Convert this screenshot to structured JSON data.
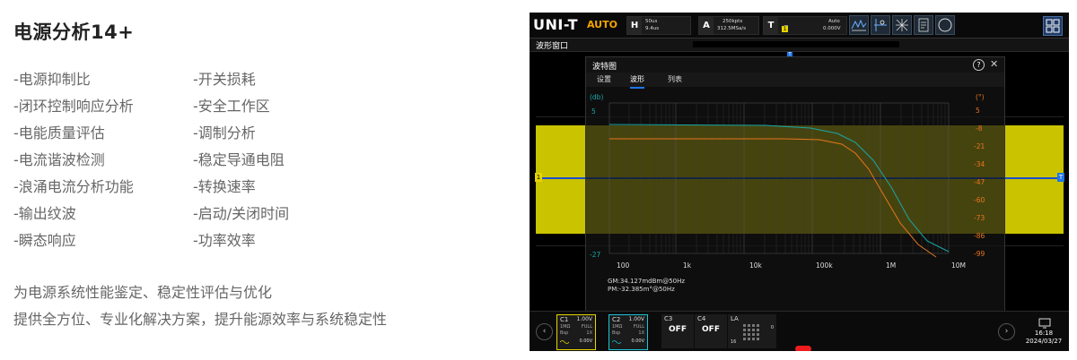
{
  "left": {
    "title": "电源分析14+",
    "features_col1": [
      "-电源抑制比",
      "-闭环控制响应分析",
      "-电能质量评估",
      "-电流谐波检测",
      "-浪涌电流分析功能",
      "-输出纹波",
      "-瞬态响应"
    ],
    "features_col2": [
      "-开关损耗",
      "-安全工作区",
      "-调制分析",
      "-稳定导通电阻",
      "-转换速率",
      "-启动/关闭时间",
      "-功率效率"
    ],
    "desc_line1": "为电源系统性能鉴定、稳定性评估与优化",
    "desc_line2": "提供全方位、专业化解决方案，提升能源效率与系统稳定性"
  },
  "scope": {
    "logo": "UNI-T",
    "mode": "AUTO",
    "horizontal": {
      "key": "H",
      "line1": "50us",
      "line2": "9.4us"
    },
    "acquire": {
      "key": "A",
      "line1": "250kpts",
      "line2": "312.5MSa/s"
    },
    "trigger": {
      "key": "T",
      "channel": "1",
      "line1": "Auto",
      "line2": "0.000V"
    },
    "window_title": "波形窗口",
    "marker_left": "1",
    "marker_right": "T",
    "dialog": {
      "title": "波特图",
      "help": "?",
      "close": "✕",
      "tabs": [
        "设置",
        "波形",
        "列表"
      ],
      "active_tab": 1,
      "left_unit": "(db)",
      "right_unit": "(°)",
      "gain_ticks": [
        5,
        "",
        "",
        "",
        "",
        "",
        "",
        "",
        "",
        "",
        "-27"
      ],
      "phase_ticks": [
        "(°)",
        "5",
        "-8",
        "-21",
        "-34",
        "-47",
        "-60",
        "-73",
        "-86",
        "-99"
      ],
      "freq_ticks": [
        "100",
        "1k",
        "10k",
        "100k",
        "1M",
        "10M"
      ],
      "gm": "GM:34.127mdBm@50Hz",
      "pm": "PM:-32.385m°@50Hz"
    },
    "channels": [
      {
        "name": "C1",
        "volt": "1.00V",
        "imp": "1MΩ",
        "bw": "FULL",
        "bias": "Bsp",
        "probe": "1X",
        "offset": "0.00V",
        "color": "#e7d400"
      },
      {
        "name": "C2",
        "volt": "1.00V",
        "imp": "1MΩ",
        "bw": "FULL",
        "bias": "Bsp",
        "probe": "1X",
        "offset": "0.00V",
        "color": "#19c6d6"
      },
      {
        "name": "C3",
        "status": "OFF"
      },
      {
        "name": "C4",
        "status": "OFF"
      },
      {
        "name": "LA",
        "count": "0",
        "sub": "16"
      }
    ],
    "time": "16:18",
    "date": "2024/03/27",
    "colors": {
      "yellow_band": "#c9c300",
      "orange_curve": "#e8761e",
      "cyan_curve": "#19a8a8",
      "accent_blue": "#1e76e8"
    }
  }
}
